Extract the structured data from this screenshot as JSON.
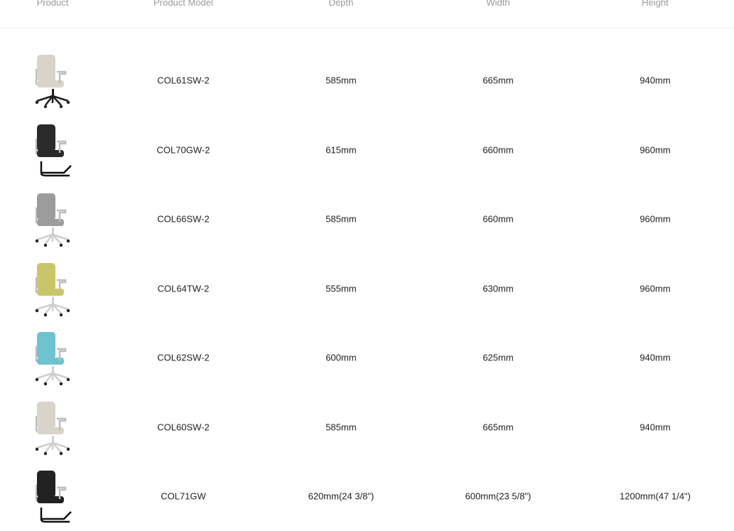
{
  "table": {
    "headers": {
      "product": "Product",
      "model": "Product Model",
      "depth": "Depth",
      "width": "Width",
      "height": "Height"
    },
    "rows": [
      {
        "model": "COL61SW-2",
        "depth": "585mm",
        "width": "665mm",
        "height": "940mm",
        "seat_color": "#d9d4c9",
        "frame_color": "#1e1e1e",
        "base": "star"
      },
      {
        "model": "COL70GW-2",
        "depth": "615mm",
        "width": "660mm",
        "height": "960mm",
        "seat_color": "#2a2a2a",
        "frame_color": "#111111",
        "base": "sled"
      },
      {
        "model": "COL66SW-2",
        "depth": "585mm",
        "width": "660mm",
        "height": "960mm",
        "seat_color": "#9a9c9e",
        "frame_color": "#cfcfcf",
        "base": "star"
      },
      {
        "model": "COL64TW-2",
        "depth": "555mm",
        "width": "630mm",
        "height": "960mm",
        "seat_color": "#c9c66a",
        "frame_color": "#cfcfcf",
        "base": "star"
      },
      {
        "model": "COL62SW-2",
        "depth": "600mm",
        "width": "625mm",
        "height": "940mm",
        "seat_color": "#6fc3cf",
        "frame_color": "#cfcfcf",
        "base": "star"
      },
      {
        "model": "COL60SW-2",
        "depth": "585mm",
        "width": "665mm",
        "height": "940mm",
        "seat_color": "#d9d4c9",
        "frame_color": "#cfcfcf",
        "base": "star"
      },
      {
        "model": "COL71GW",
        "depth": "620mm(24 3/8\")",
        "width": "600mm(23 5/8\")",
        "height": "1200mm(47 1/4\")",
        "seat_color": "#222222",
        "frame_color": "#111111",
        "base": "sled"
      }
    ]
  }
}
